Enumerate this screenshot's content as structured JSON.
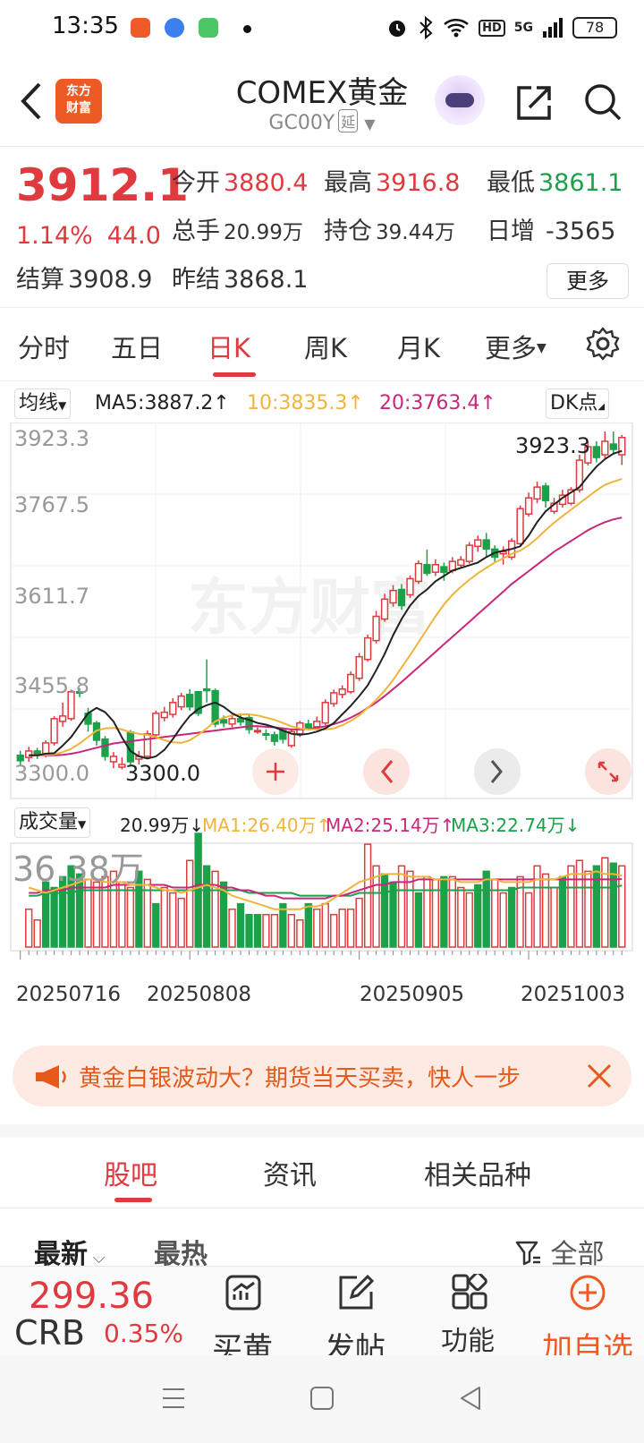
{
  "status_bar": {
    "time": "13:35",
    "network": "5G",
    "hd": "HD",
    "battery": "78"
  },
  "header": {
    "title": "COMEX黄金",
    "code": "GC00Y",
    "delay_tag": "延",
    "logo_text": "东方\n财富"
  },
  "quote": {
    "price": "3912.1",
    "change_pct": "1.14%",
    "change": "44.0",
    "open_label": "今开",
    "open": "3880.4",
    "high_label": "最高",
    "high": "3916.8",
    "low_label": "最低",
    "low": "3861.1",
    "volume_label": "总手",
    "volume": "20.99万",
    "oi_label": "持仓",
    "oi": "39.44万",
    "daily_inc_label": "日增",
    "daily_inc": "-3565",
    "settle_label": "结算",
    "settle": "3908.9",
    "prev_settle_label": "昨结",
    "prev_settle": "3868.1",
    "more_label": "更多"
  },
  "period_tabs": [
    "分时",
    "五日",
    "日K",
    "周K",
    "月K",
    "更多"
  ],
  "active_period": "日K",
  "chart_top": {
    "ma_select": "均线",
    "ma5": "MA5:3887.2",
    "ma10": "10:3835.3",
    "ma20": "20:3763.4",
    "dk_label": "DK点",
    "y_labels": [
      "3923.3",
      "3767.5",
      "3611.7",
      "3455.8",
      "3300.0"
    ],
    "max_label": "3923.3",
    "min_label": "3300.0",
    "watermark": "东方财富"
  },
  "chart_vol": {
    "select": "成交量",
    "vol": "20.99万",
    "ma1": "MA1:26.40万",
    "ma2": "MA2:25.14万",
    "ma3": "MA3:22.74万",
    "y_label": "36.38万"
  },
  "dates": [
    "20250716",
    "20250808",
    "20250905",
    "20251003"
  ],
  "colors": {
    "up": "#e0393e",
    "down": "#1aa14a",
    "ma5": "#222222",
    "ma10": "#f0b43c",
    "ma20": "#c8287a",
    "accent": "#ee5a24"
  },
  "chart_data": {
    "type": "candlestick",
    "ylim": [
      3300.0,
      3923.3
    ],
    "candles": [
      {
        "o": 3322,
        "c": 3312,
        "h": 3330,
        "l": 3304
      },
      {
        "o": 3318,
        "c": 3330,
        "h": 3338,
        "l": 3310
      },
      {
        "o": 3330,
        "c": 3322,
        "h": 3336,
        "l": 3315
      },
      {
        "o": 3325,
        "c": 3345,
        "h": 3350,
        "l": 3318
      },
      {
        "o": 3345,
        "c": 3390,
        "h": 3395,
        "l": 3340
      },
      {
        "o": 3385,
        "c": 3395,
        "h": 3420,
        "l": 3375
      },
      {
        "o": 3390,
        "c": 3440,
        "h": 3444,
        "l": 3386
      },
      {
        "o": 3440,
        "c": 3438,
        "h": 3446,
        "l": 3430
      },
      {
        "o": 3400,
        "c": 3380,
        "h": 3410,
        "l": 3366
      },
      {
        "o": 3382,
        "c": 3350,
        "h": 3386,
        "l": 3340
      },
      {
        "o": 3352,
        "c": 3320,
        "h": 3358,
        "l": 3312
      },
      {
        "o": 3310,
        "c": 3320,
        "h": 3328,
        "l": 3298
      },
      {
        "o": 3300,
        "c": 3305,
        "h": 3318,
        "l": 3296
      },
      {
        "o": 3365,
        "c": 3310,
        "h": 3369,
        "l": 3304
      },
      {
        "o": 3315,
        "c": 3320,
        "h": 3330,
        "l": 3305
      },
      {
        "o": 3320,
        "c": 3362,
        "h": 3368,
        "l": 3318
      },
      {
        "o": 3360,
        "c": 3400,
        "h": 3405,
        "l": 3356
      },
      {
        "o": 3392,
        "c": 3402,
        "h": 3412,
        "l": 3385
      },
      {
        "o": 3398,
        "c": 3420,
        "h": 3428,
        "l": 3392
      },
      {
        "o": 3412,
        "c": 3432,
        "h": 3438,
        "l": 3406
      },
      {
        "o": 3435,
        "c": 3412,
        "h": 3445,
        "l": 3405
      },
      {
        "o": 3440,
        "c": 3400,
        "h": 3440,
        "l": 3395
      },
      {
        "o": 3445,
        "c": 3442,
        "h": 3500,
        "l": 3420
      },
      {
        "o": 3442,
        "c": 3380,
        "h": 3446,
        "l": 3374
      },
      {
        "o": 3388,
        "c": 3382,
        "h": 3396,
        "l": 3374
      },
      {
        "o": 3380,
        "c": 3390,
        "h": 3398,
        "l": 3374
      },
      {
        "o": 3390,
        "c": 3384,
        "h": 3400,
        "l": 3377
      },
      {
        "o": 3392,
        "c": 3370,
        "h": 3398,
        "l": 3362
      },
      {
        "o": 3368,
        "c": 3368,
        "h": 3374,
        "l": 3362
      },
      {
        "o": 3362,
        "c": 3360,
        "h": 3370,
        "l": 3350
      },
      {
        "o": 3360,
        "c": 3348,
        "h": 3366,
        "l": 3340
      },
      {
        "o": 3368,
        "c": 3352,
        "h": 3374,
        "l": 3344
      },
      {
        "o": 3340,
        "c": 3366,
        "h": 3372,
        "l": 3336
      },
      {
        "o": 3362,
        "c": 3382,
        "h": 3386,
        "l": 3356
      },
      {
        "o": 3380,
        "c": 3372,
        "h": 3388,
        "l": 3368
      },
      {
        "o": 3375,
        "c": 3385,
        "h": 3394,
        "l": 3370
      },
      {
        "o": 3382,
        "c": 3420,
        "h": 3426,
        "l": 3378
      },
      {
        "o": 3418,
        "c": 3438,
        "h": 3444,
        "l": 3412
      },
      {
        "o": 3435,
        "c": 3445,
        "h": 3452,
        "l": 3428
      },
      {
        "o": 3440,
        "c": 3472,
        "h": 3478,
        "l": 3436
      },
      {
        "o": 3465,
        "c": 3505,
        "h": 3512,
        "l": 3460
      },
      {
        "o": 3500,
        "c": 3540,
        "h": 3546,
        "l": 3496
      },
      {
        "o": 3535,
        "c": 3580,
        "h": 3590,
        "l": 3530
      },
      {
        "o": 3575,
        "c": 3612,
        "h": 3622,
        "l": 3570
      },
      {
        "o": 3605,
        "c": 3628,
        "h": 3638,
        "l": 3598
      },
      {
        "o": 3630,
        "c": 3600,
        "h": 3640,
        "l": 3592
      },
      {
        "o": 3620,
        "c": 3650,
        "h": 3656,
        "l": 3614
      },
      {
        "o": 3645,
        "c": 3678,
        "h": 3684,
        "l": 3640
      },
      {
        "o": 3676,
        "c": 3660,
        "h": 3704,
        "l": 3655
      },
      {
        "o": 3662,
        "c": 3676,
        "h": 3686,
        "l": 3655
      },
      {
        "o": 3672,
        "c": 3662,
        "h": 3680,
        "l": 3646
      },
      {
        "o": 3665,
        "c": 3682,
        "h": 3690,
        "l": 3660
      },
      {
        "o": 3675,
        "c": 3685,
        "h": 3692,
        "l": 3668
      },
      {
        "o": 3682,
        "c": 3712,
        "h": 3718,
        "l": 3678
      },
      {
        "o": 3710,
        "c": 3722,
        "h": 3730,
        "l": 3700
      },
      {
        "o": 3722,
        "c": 3705,
        "h": 3735,
        "l": 3690
      },
      {
        "o": 3705,
        "c": 3690,
        "h": 3712,
        "l": 3680
      },
      {
        "o": 3696,
        "c": 3700,
        "h": 3710,
        "l": 3676
      },
      {
        "o": 3690,
        "c": 3720,
        "h": 3725,
        "l": 3685
      },
      {
        "o": 3715,
        "c": 3780,
        "h": 3786,
        "l": 3712
      },
      {
        "o": 3770,
        "c": 3800,
        "h": 3810,
        "l": 3765
      },
      {
        "o": 3798,
        "c": 3820,
        "h": 3830,
        "l": 3790
      },
      {
        "o": 3822,
        "c": 3795,
        "h": 3828,
        "l": 3782
      },
      {
        "o": 3775,
        "c": 3790,
        "h": 3800,
        "l": 3770
      },
      {
        "o": 3788,
        "c": 3805,
        "h": 3815,
        "l": 3782
      },
      {
        "o": 3790,
        "c": 3815,
        "h": 3820,
        "l": 3786
      },
      {
        "o": 3815,
        "c": 3870,
        "h": 3880,
        "l": 3810
      },
      {
        "o": 3865,
        "c": 3895,
        "h": 3905,
        "l": 3860
      },
      {
        "o": 3895,
        "c": 3875,
        "h": 3905,
        "l": 3866
      },
      {
        "o": 3880,
        "c": 3905,
        "h": 3923.3,
        "l": 3874
      },
      {
        "o": 3900,
        "c": 3890,
        "h": 3923.3,
        "l": 3880
      },
      {
        "o": 3880,
        "c": 3912.1,
        "h": 3916.8,
        "l": 3861.1
      }
    ],
    "ma5": [
      3322,
      3322,
      3325,
      3326,
      3340,
      3356,
      3378,
      3400,
      3410,
      3402,
      3385,
      3355,
      3330,
      3320,
      3316,
      3320,
      3332,
      3352,
      3375,
      3395,
      3408,
      3415,
      3420,
      3412,
      3400,
      3392,
      3388,
      3382,
      3379,
      3374,
      3368,
      3362,
      3360,
      3362,
      3366,
      3372,
      3382,
      3398,
      3414,
      3432,
      3452,
      3480,
      3510,
      3545,
      3575,
      3600,
      3618,
      3630,
      3645,
      3655,
      3665,
      3670,
      3675,
      3680,
      3690,
      3698,
      3702,
      3705,
      3710,
      3730,
      3755,
      3775,
      3788,
      3800,
      3810,
      3820,
      3840,
      3858,
      3872,
      3882,
      3887.2
    ],
    "ma10": [
      3322,
      3322,
      3323,
      3324,
      3328,
      3334,
      3344,
      3356,
      3368,
      3372,
      3373,
      3370,
      3365,
      3362,
      3360,
      3356,
      3350,
      3346,
      3345,
      3350,
      3360,
      3372,
      3385,
      3392,
      3396,
      3398,
      3398,
      3396,
      3392,
      3388,
      3382,
      3376,
      3372,
      3370,
      3370,
      3370,
      3372,
      3378,
      3386,
      3396,
      3410,
      3425,
      3442,
      3462,
      3485,
      3508,
      3532,
      3556,
      3580,
      3602,
      3620,
      3635,
      3648,
      3660,
      3670,
      3680,
      3688,
      3696,
      3702,
      3712,
      3725,
      3740,
      3754,
      3766,
      3778,
      3790,
      3802,
      3814,
      3824,
      3830,
      3835.3
    ],
    "ma20": [
      3322,
      3322,
      3322,
      3322,
      3323,
      3325,
      3328,
      3332,
      3336,
      3340,
      3344,
      3346,
      3348,
      3350,
      3352,
      3354,
      3356,
      3358,
      3360,
      3362,
      3364,
      3366,
      3368,
      3370,
      3372,
      3374,
      3376,
      3376,
      3375,
      3374,
      3372,
      3370,
      3370,
      3371,
      3373,
      3376,
      3380,
      3385,
      3392,
      3400,
      3410,
      3420,
      3432,
      3445,
      3458,
      3472,
      3486,
      3500,
      3514,
      3528,
      3542,
      3556,
      3570,
      3584,
      3598,
      3612,
      3626,
      3640,
      3652,
      3664,
      3676,
      3688,
      3700,
      3710,
      3720,
      3730,
      3740,
      3748,
      3755,
      3760,
      3763.4
    ],
    "volume": {
      "ymax": 36.38,
      "values": [
        14,
        10,
        24,
        22,
        26,
        30,
        27,
        25,
        24,
        26,
        28,
        24,
        22,
        28,
        25,
        16,
        22,
        20,
        18,
        32,
        42,
        30,
        28,
        24,
        14,
        16,
        12,
        12,
        12,
        12,
        16,
        12,
        10,
        16,
        14,
        16,
        12,
        14,
        14,
        18,
        38,
        30,
        27,
        24,
        30,
        28,
        20,
        26,
        25,
        26,
        26,
        22,
        20,
        23,
        28,
        25,
        20,
        22,
        26,
        20,
        30,
        27,
        22,
        26,
        30,
        32,
        28,
        30,
        33,
        31,
        30
      ],
      "up": [
        1,
        1,
        0,
        0,
        0,
        0,
        0,
        1,
        1,
        1,
        1,
        1,
        1,
        0,
        1,
        0,
        1,
        1,
        1,
        1,
        0,
        0,
        1,
        0,
        1,
        0,
        0,
        0,
        1,
        1,
        0,
        1,
        1,
        0,
        1,
        1,
        1,
        1,
        1,
        1,
        1,
        1,
        0,
        0,
        1,
        1,
        0,
        1,
        1,
        0,
        1,
        1,
        1,
        0,
        0,
        1,
        1,
        0,
        1,
        1,
        1,
        1,
        1,
        0,
        1,
        1,
        1,
        0,
        1,
        0,
        1
      ],
      "ma1": [
        22,
        21,
        20,
        21,
        22,
        23,
        24,
        25,
        25,
        24,
        24,
        24,
        23,
        23,
        23,
        22,
        21,
        21,
        20,
        21,
        22,
        23,
        22,
        21,
        19,
        18,
        17,
        16,
        15,
        14,
        14,
        14,
        14,
        15,
        15,
        16,
        18,
        20,
        22,
        24,
        25,
        26,
        27,
        27,
        27,
        26,
        26,
        26,
        25,
        25,
        25,
        24,
        24,
        24,
        25,
        25,
        24,
        24,
        24,
        24,
        25,
        25,
        25,
        26,
        27,
        27,
        27,
        28,
        27,
        27,
        26.4
      ],
      "ma2": [
        20,
        20,
        21,
        21,
        21,
        22,
        22,
        22,
        22,
        22,
        23,
        23,
        23,
        23,
        23,
        23,
        23,
        22,
        22,
        22,
        23,
        23,
        23,
        22,
        22,
        21,
        21,
        20,
        19,
        19,
        18,
        18,
        18,
        18,
        18,
        18,
        19,
        19,
        20,
        21,
        22,
        23,
        23,
        24,
        24,
        24,
        25,
        25,
        25,
        25,
        25,
        25,
        25,
        25,
        25,
        25,
        25,
        25,
        25,
        25,
        25,
        25,
        25,
        25,
        25,
        25,
        25,
        25,
        25,
        25,
        25.14
      ],
      "ma3": [
        19,
        19,
        20,
        20,
        20,
        20,
        21,
        21,
        21,
        21,
        21,
        21,
        21,
        21,
        21,
        21,
        21,
        21,
        21,
        21,
        21,
        21,
        21,
        21,
        21,
        21,
        20,
        20,
        20,
        20,
        20,
        20,
        19,
        19,
        19,
        19,
        19,
        19,
        19,
        20,
        20,
        20,
        20,
        21,
        21,
        21,
        21,
        21,
        21,
        21,
        21,
        21,
        21,
        21,
        21,
        21,
        21,
        21,
        22,
        22,
        22,
        22,
        22,
        22,
        22,
        22,
        22,
        22,
        22,
        22,
        22.74
      ]
    }
  },
  "ad": {
    "text": "黄金白银波动大？期货当天买卖，快人一步"
  },
  "section_tabs": [
    "股吧",
    "资讯",
    "相关品种"
  ],
  "filters": {
    "latest": "最新",
    "hot": "最热",
    "all": "全部"
  },
  "bottom_bar": {
    "crb_value": "299.36",
    "crb_name": "CRB",
    "crb_pct": "0.35%",
    "buy_label": "买黄",
    "post_label": "发帖",
    "func_label": "功能",
    "add_label": "加自选"
  }
}
